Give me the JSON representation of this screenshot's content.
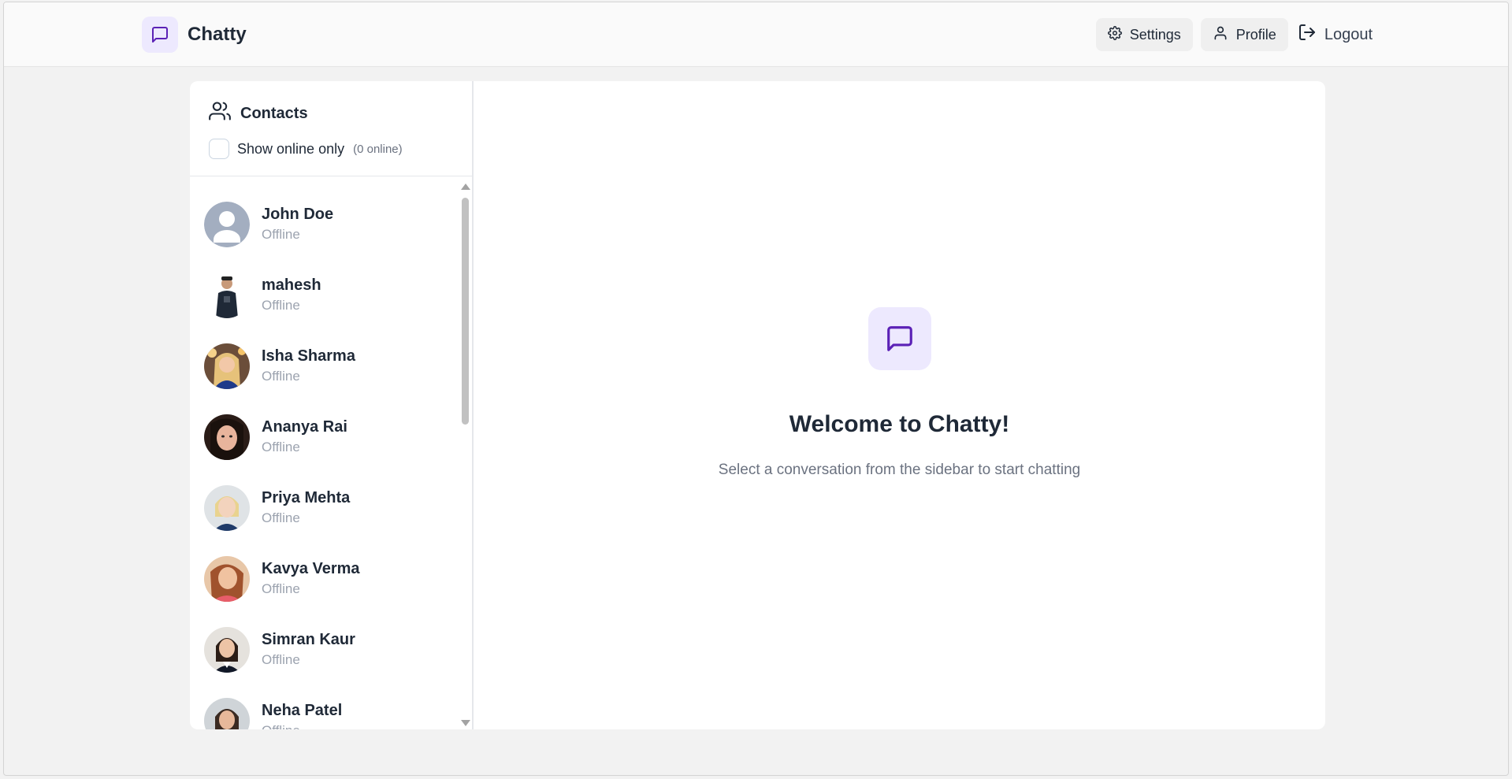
{
  "header": {
    "brand": "Chatty",
    "settings_label": "Settings",
    "profile_label": "Profile",
    "logout_label": "Logout"
  },
  "sidebar": {
    "title": "Contacts",
    "show_online_label": "Show online only",
    "online_count": "(0 online)",
    "contacts": [
      {
        "name": "John Doe",
        "status": "Offline",
        "avatar": "default-avatar"
      },
      {
        "name": "mahesh",
        "status": "Offline",
        "avatar": "photo"
      },
      {
        "name": "Isha Sharma",
        "status": "Offline",
        "avatar": "photo"
      },
      {
        "name": "Ananya Rai",
        "status": "Offline",
        "avatar": "photo"
      },
      {
        "name": "Priya Mehta",
        "status": "Offline",
        "avatar": "photo"
      },
      {
        "name": "Kavya Verma",
        "status": "Offline",
        "avatar": "photo"
      },
      {
        "name": "Simran Kaur",
        "status": "Offline",
        "avatar": "photo"
      },
      {
        "name": "Neha Patel",
        "status": "Offline",
        "avatar": "photo"
      }
    ]
  },
  "welcome": {
    "title": "Welcome to Chatty!",
    "subtitle": "Select a conversation from the sidebar to start chatting"
  },
  "colors": {
    "accent": "#5b21b6",
    "accent_bg": "#ede9fe",
    "page_bg": "#f2f2f2"
  }
}
